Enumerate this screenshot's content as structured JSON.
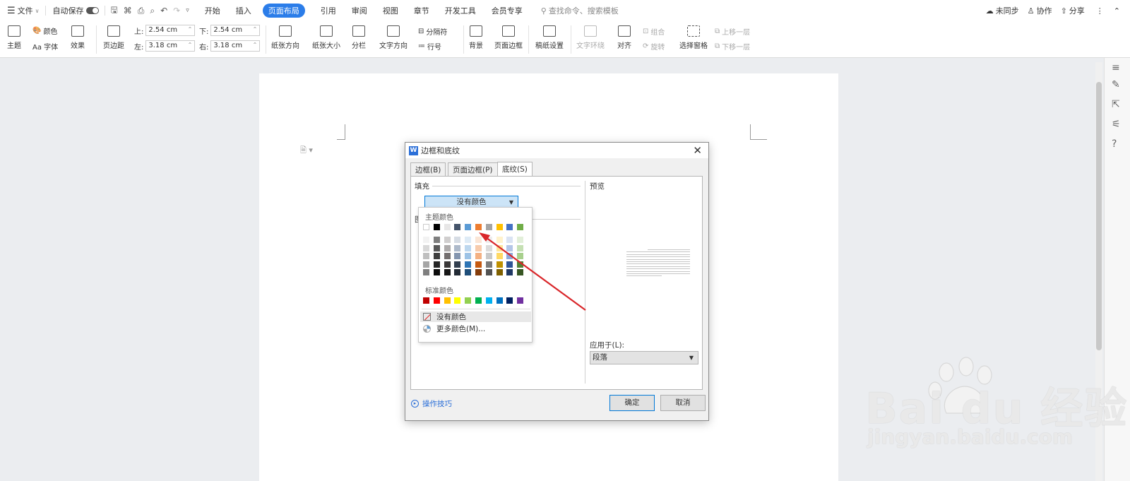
{
  "menubar": {
    "file": "文件",
    "autosave": "自动保存",
    "tabs": [
      "开始",
      "插入",
      "页面布局",
      "引用",
      "审阅",
      "视图",
      "章节",
      "开发工具",
      "会员专享"
    ],
    "active_tab": "页面布局",
    "search_placeholder": "查找命令、搜索模板",
    "right": {
      "sync": "未同步",
      "collab": "协作",
      "share": "分享"
    }
  },
  "ribbon": {
    "theme": "主题",
    "color": "颜色",
    "font": "Aa 字体",
    "effect": "效果",
    "margins": "页边距",
    "top_label": "上:",
    "top_value": "2.54 cm",
    "bottom_label": "下:",
    "bottom_value": "2.54 cm",
    "left_label": "左:",
    "left_value": "3.18 cm",
    "right_label": "右:",
    "right_value": "3.18 cm",
    "orientation": "纸张方向",
    "size": "纸张大小",
    "columns": "分栏",
    "text_direction": "文字方向",
    "breaks": "分隔符",
    "line_numbers": "行号",
    "background": "背景",
    "page_border": "页面边框",
    "manuscript": "稿纸设置",
    "text_wrap": "文字环绕",
    "align": "对齐",
    "group": "组合",
    "rotate": "旋转",
    "selection_pane": "选择窗格",
    "bring_forward": "上移一层",
    "send_backward": "下移一层"
  },
  "dialog": {
    "title": "边框和底纹",
    "tabs": [
      "边框(B)",
      "页面边框(P)",
      "底纹(S)"
    ],
    "fill_label": "填充",
    "fill_value": "没有颜色",
    "pattern_label": "图",
    "preview_label": "预览",
    "apply_label": "应用于(L):",
    "apply_value": "段落",
    "hint": "操作技巧",
    "ok": "确定",
    "cancel": "取消"
  },
  "color_menu": {
    "theme_label": "主题颜色",
    "standard_label": "标准颜色",
    "no_color": "没有颜色",
    "more_colors": "更多颜色(M)...",
    "theme_colors": [
      "#ffffff",
      "#000000",
      "#e7e6e6",
      "#44546a",
      "#5b9bd5",
      "#ed7d31",
      "#a5a5a5",
      "#ffc000",
      "#4472c4",
      "#70ad47"
    ],
    "theme_shades": [
      [
        "#f2f2f2",
        "#7f7f7f",
        "#d0cece",
        "#d6dce4",
        "#deebf6",
        "#fbe5d5",
        "#ededed",
        "#fff2cc",
        "#dae3f3",
        "#e2efd9"
      ],
      [
        "#d8d8d8",
        "#595959",
        "#aeabab",
        "#adb9ca",
        "#bdd7ee",
        "#f7cbac",
        "#dbdbdb",
        "#fee599",
        "#b4c6e7",
        "#c5e0b3"
      ],
      [
        "#bfbfbf",
        "#3f3f3f",
        "#757070",
        "#8496b0",
        "#9dc3e6",
        "#f4b183",
        "#c9c9c9",
        "#ffd965",
        "#8eaadb",
        "#a8d08d"
      ],
      [
        "#a5a5a5",
        "#262626",
        "#3a3838",
        "#323f4f",
        "#2e75b5",
        "#c55a11",
        "#7b7b7b",
        "#bf9000",
        "#2f5496",
        "#538135"
      ],
      [
        "#7f7f7f",
        "#0c0c0c",
        "#171616",
        "#222a35",
        "#1e4e79",
        "#843c0b",
        "#525252",
        "#7f6000",
        "#1f3864",
        "#375623"
      ]
    ],
    "standard_colors": [
      "#c00000",
      "#ff0000",
      "#ffc000",
      "#ffff00",
      "#92d050",
      "#00b050",
      "#00b0f0",
      "#0070c0",
      "#002060",
      "#7030a0"
    ]
  },
  "colors": {
    "accent": "#2b7de9",
    "arrow": "#d9262a"
  }
}
